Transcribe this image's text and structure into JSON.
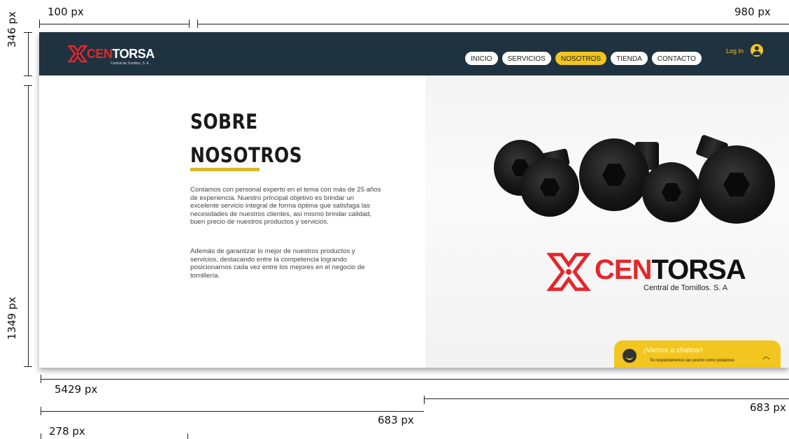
{
  "annotations": {
    "top_left_width": "100 px",
    "top_right_width": "980 px",
    "header_height": "346 px",
    "content_height": "1349 px",
    "frame_width": "5429 px",
    "left_half": "683 px",
    "right_half": "683 px",
    "text_offset": "278 px"
  },
  "header": {
    "logo_prefix": "CEN",
    "logo_suffix": "TORSA",
    "logo_sub": "Central de Tornillos, S. A",
    "nav": [
      {
        "label": "INICIO",
        "active": false
      },
      {
        "label": "SERVICIOS",
        "active": false
      },
      {
        "label": "NOSOTROS",
        "active": true
      },
      {
        "label": "TIENDA",
        "active": false
      },
      {
        "label": "CONTACTO",
        "active": false
      }
    ],
    "login": "Log In",
    "user_icon": "user-circle-icon"
  },
  "about": {
    "title_line1": "SOBRE",
    "title_line2": "NOSOTROS",
    "paragraph1": "Contamos con personal experto en el tema con más de 25 años de experiencia. Nuestro principal objetivo es brindar un excelente servicio integral de forma óptima que satisfaga las necesidades de nuestros clientes, así mismo brindar calidad, buen precio de nuestros productos y servicios.",
    "paragraph2": "Además de garantizar lo mejor de nuestros productos y servicios, destacando entre la competencia logrando posicionarnos cada vez entre los mejores en el negocio de tornillería."
  },
  "hero": {
    "logo_prefix": "CEN",
    "logo_suffix": "TORSA",
    "logo_sub": "Central de Tornillos. S. A"
  },
  "chat": {
    "title": "¡Vamos a chatear!",
    "subtitle": "Te responderemos tan pronto como podamos",
    "bolt_icon": "lightning-icon",
    "chevron_icon": "chevron-up-icon"
  },
  "colors": {
    "header_bg": "#1f3240",
    "accent_yellow": "#f2c61f",
    "brand_red": "#e4262b"
  }
}
